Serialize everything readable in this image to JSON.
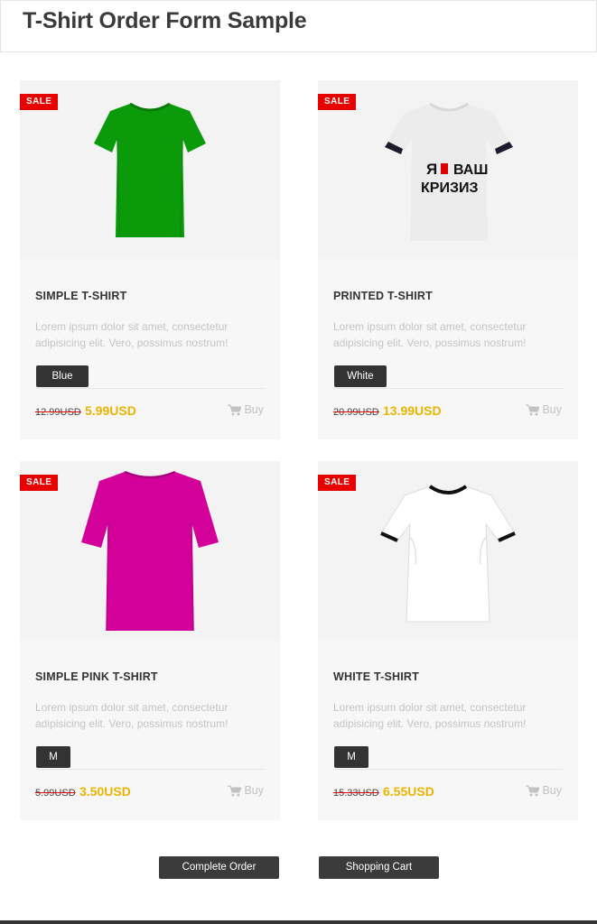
{
  "page": {
    "title": "T-Shirt Order Form Sample"
  },
  "products": [
    {
      "badge": "SALE",
      "title": "SIMPLE T-SHIRT",
      "description": "Lorem ipsum dolor sit amet, consectetur adipisicing elit. Vero, possimus nostrum!",
      "option": "Blue",
      "old_price": "12.99USD",
      "new_price": "5.99USD",
      "buy_label": "Buy",
      "shirt_color": "#0a9a0a"
    },
    {
      "badge": "SALE",
      "title": "PRINTED T-SHIRT",
      "description": "Lorem ipsum dolor sit amet, consectetur adipisicing elit. Vero, possimus nostrum!",
      "option": "White",
      "old_price": "20.99USD",
      "new_price": "13.99USD",
      "buy_label": "Buy",
      "shirt_color": "#eeeeee",
      "print_text": [
        "Я",
        "ВАШ",
        "КРИЗИЗ"
      ]
    },
    {
      "badge": "SALE",
      "title": "SIMPLE PINK T-SHIRT",
      "description": "Lorem ipsum dolor sit amet, consectetur adipisicing elit. Vero, possimus nostrum!",
      "option": "M",
      "old_price": "5.99USD",
      "new_price": "3.50USD",
      "buy_label": "Buy",
      "shirt_color": "#d4009a"
    },
    {
      "badge": "SALE",
      "title": "WHITE T-SHIRT",
      "description": "Lorem ipsum dolor sit amet, consectetur adipisicing elit. Vero, possimus nostrum!",
      "option": "M",
      "old_price": "15.33USD",
      "new_price": "6.55USD",
      "buy_label": "Buy",
      "shirt_color": "#ffffff"
    }
  ],
  "actions": {
    "complete_order": "Complete Order",
    "shopping_cart": "Shopping Cart"
  },
  "icons": {
    "cart": "shopping-cart-icon"
  },
  "colors": {
    "sale": "#e80000",
    "price": "#e8b400",
    "button": "#333333"
  }
}
